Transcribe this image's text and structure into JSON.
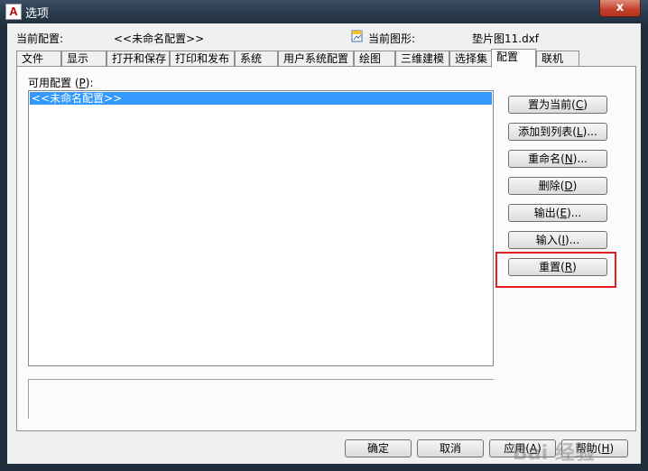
{
  "window": {
    "title": "选项",
    "close_label": "x"
  },
  "header": {
    "current_profile_label": "当前配置:",
    "current_profile_value": "<<未命名配置>>",
    "current_drawing_label": "当前图形:",
    "current_drawing_value": "垫片图11.dxf"
  },
  "tabs": [
    "文件",
    "显示",
    "打开和保存",
    "打印和发布",
    "系统",
    "用户系统配置",
    "绘图",
    "三维建模",
    "选择集",
    "配置",
    "联机"
  ],
  "active_tab": "配置",
  "profiles": {
    "label": "可用配置",
    "label_key": "P",
    "items": [
      "<<未命名配置>>"
    ]
  },
  "side_buttons": [
    {
      "label": "置为当前",
      "key": "C",
      "suffix": ""
    },
    {
      "label": "添加到列表",
      "key": "L",
      "suffix": "..."
    },
    {
      "label": "重命名",
      "key": "N",
      "suffix": "..."
    },
    {
      "label": "删除",
      "key": "D",
      "suffix": ""
    },
    {
      "label": "输出",
      "key": "E",
      "suffix": "..."
    },
    {
      "label": "输入",
      "key": "I",
      "suffix": "..."
    },
    {
      "label": "重置",
      "key": "R",
      "suffix": ""
    }
  ],
  "footer": {
    "ok": "确定",
    "cancel": "取消",
    "apply": "应用",
    "apply_key": "A",
    "help": "帮助",
    "help_key": "H"
  },
  "watermark": "Bai 经验",
  "highlight_color": "#e02020"
}
